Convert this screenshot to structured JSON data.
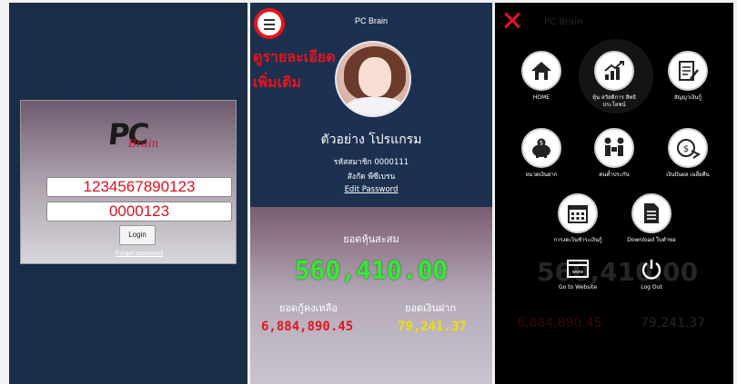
{
  "login": {
    "logo_text": "PC",
    "logo_subtext": "Brain",
    "member_id_value": "1234567890123",
    "password_value": "0000123",
    "login_label": "Login",
    "forgot_label": "Forgot password"
  },
  "profile": {
    "app_title": "PC Brain",
    "annotation_line1": "ดูรายละเอียด",
    "annotation_line2": "เพิ่มเติม",
    "name": "ตัวอย่าง โปรแกรม",
    "member_code": "รหัสสมาชิก 0000111",
    "affiliation": "สังกัด พีซีเบรน",
    "edit_password": "Edit Password",
    "shares_label": "ยอดหุ้นสะสม",
    "shares_value": "560,410.00",
    "loan_label": "ยอดกู้คงเหลือ",
    "loan_value": "6,884,890.45",
    "deposit_label": "ยอดเงินฝาก",
    "deposit_value": "79,241.37"
  },
  "menu": {
    "items": [
      {
        "icon": "home-icon",
        "label": "HOME"
      },
      {
        "icon": "chart-icon",
        "label": "หุ้น สวัสดิการ สิทธิประโยชน์"
      },
      {
        "icon": "contract-icon",
        "label": "สัญญาเงินกู้"
      },
      {
        "icon": "piggy-bank-icon",
        "label": "หมวดเงินฝาก"
      },
      {
        "icon": "beneficiary-icon",
        "label": "คนค้ำประกัน"
      },
      {
        "icon": "dividend-icon",
        "label": "เงินปันผล เฉลี่ยคืน"
      },
      {
        "icon": "calendar-icon",
        "label": "การงดเว้นชำระเงินกู้"
      },
      {
        "icon": "document-icon",
        "label": "Download ใบคำขอ"
      },
      {
        "icon": "website-icon",
        "label": "Go to Website"
      },
      {
        "icon": "power-icon",
        "label": "Log Out"
      }
    ],
    "ghost_shares": "560,410.00",
    "ghost_deposit": "79,241.37",
    "ghost_loan": "6,884,890.45",
    "ghost_card_title": "PC Brain"
  },
  "colors": {
    "accent_red": "#e8141c",
    "green_value": "#39e639",
    "yellow_value": "#f0e000",
    "navy": "#1a2d47"
  }
}
